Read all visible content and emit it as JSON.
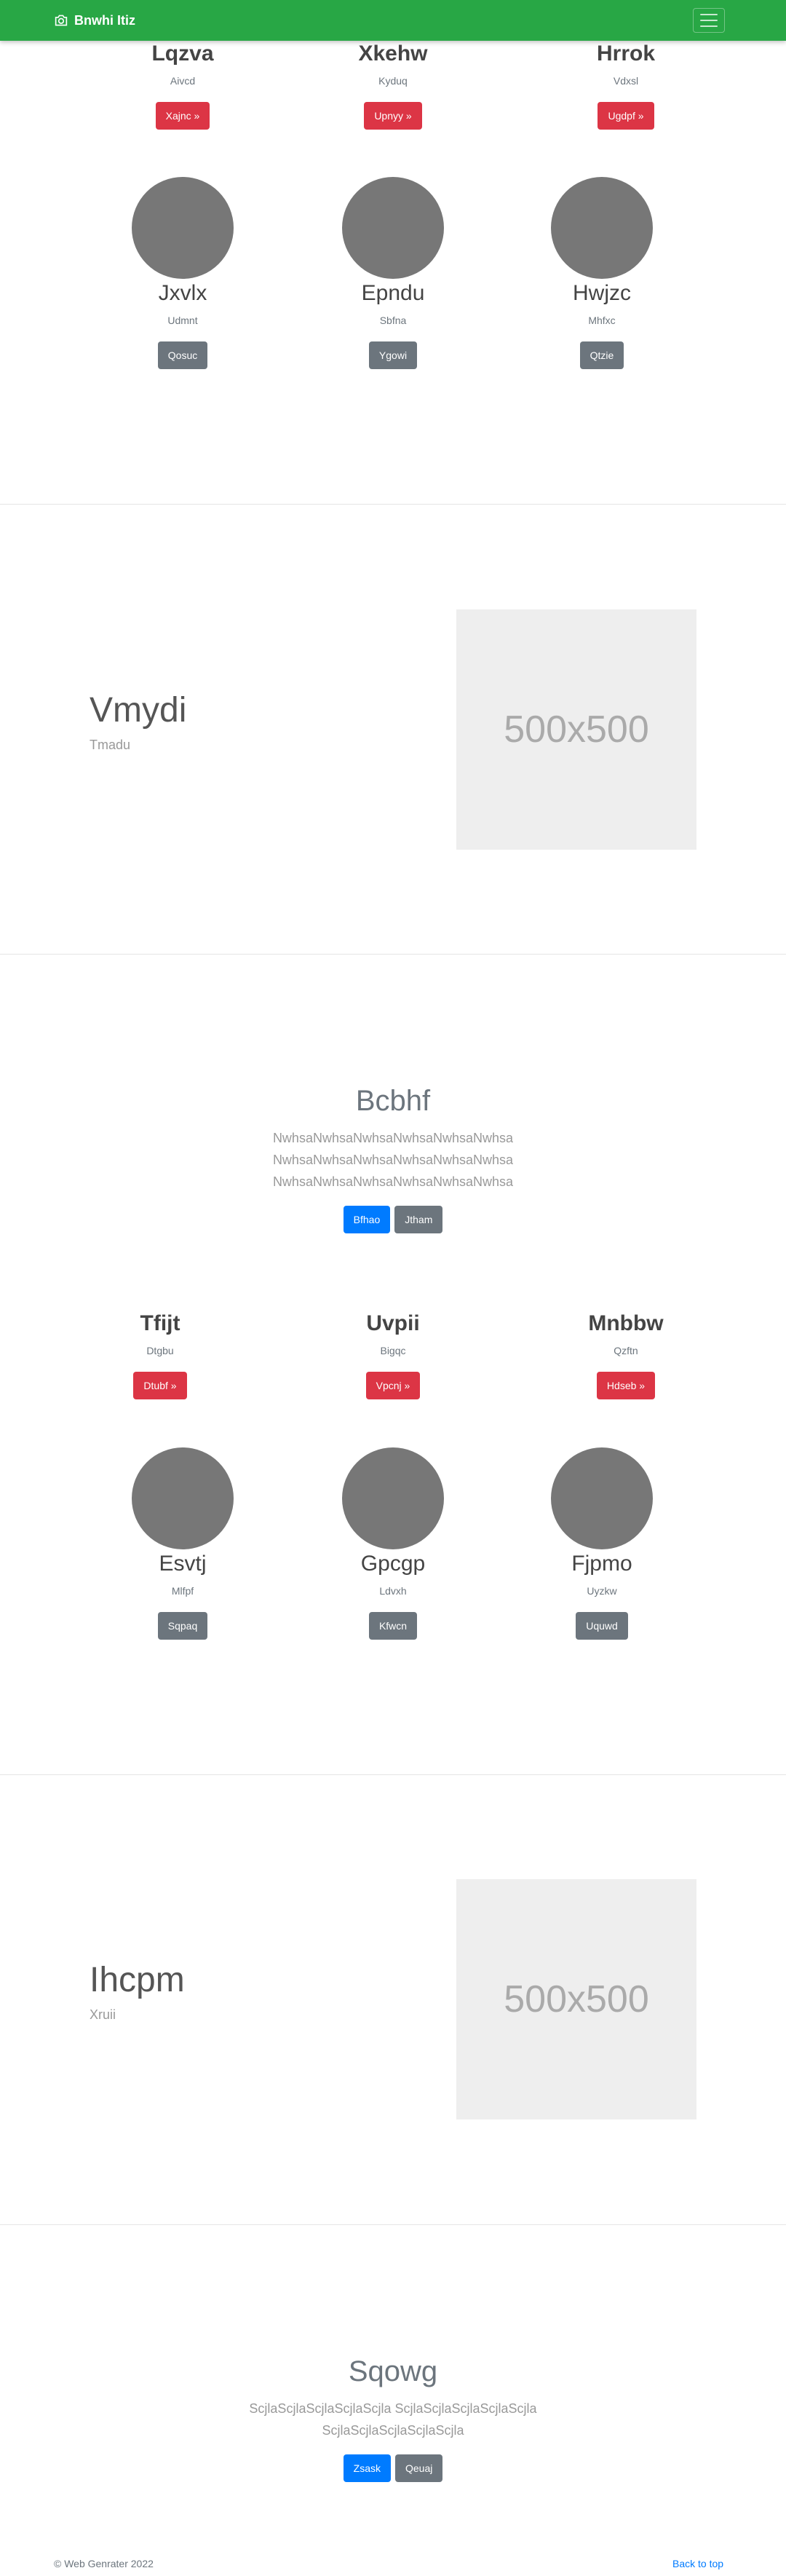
{
  "navbar": {
    "brand": "Bnwhi Itiz",
    "brand_icon": "camera-icon",
    "toggler_icon": "hamburger-icon"
  },
  "features1": [
    {
      "title": "Lqzva",
      "subtitle": "Aivcd",
      "button": "Xajnc »"
    },
    {
      "title": "Xkehw",
      "subtitle": "Kyduq",
      "button": "Upnyy »"
    },
    {
      "title": "Hrrok",
      "subtitle": "Vdxsl",
      "button": "Ugdpf »"
    }
  ],
  "members1": [
    {
      "name": "Jxvlx",
      "subtitle": "Udmnt",
      "button": "Qosuc"
    },
    {
      "name": "Epndu",
      "subtitle": "Sbfna",
      "button": "Ygowi"
    },
    {
      "name": "Hwjzc",
      "subtitle": "Mhfxc",
      "button": "Qtzie"
    }
  ],
  "split1": {
    "title": "Vmydi",
    "subtitle": "Tmadu",
    "image_label": "500x500"
  },
  "hero1": {
    "title": "Bcbhf",
    "lines": [
      "NwhsaNwhsaNwhsaNwhsaNwhsaNwhsa",
      "NwhsaNwhsaNwhsaNwhsaNwhsaNwhsa",
      "NwhsaNwhsaNwhsaNwhsaNwhsaNwhsa"
    ],
    "primary_button": "Bfhao",
    "secondary_button": "Jtham"
  },
  "features2": [
    {
      "title": "Tfijt",
      "subtitle": "Dtgbu",
      "button": "Dtubf »"
    },
    {
      "title": "Uvpii",
      "subtitle": "Bigqc",
      "button": "Vpcnj »"
    },
    {
      "title": "Mnbbw",
      "subtitle": "Qzftn",
      "button": "Hdseb »"
    }
  ],
  "members2": [
    {
      "name": "Esvtj",
      "subtitle": "Mlfpf",
      "button": "Sqpaq"
    },
    {
      "name": "Gpcgp",
      "subtitle": "Ldvxh",
      "button": "Kfwcn"
    },
    {
      "name": "Fjpmo",
      "subtitle": "Uyzkw",
      "button": "Uquwd"
    }
  ],
  "split2": {
    "title": "Ihcpm",
    "subtitle": "Xruii",
    "image_label": "500x500"
  },
  "hero2": {
    "title": "Sqowg",
    "lines": [
      "ScjlaScjlaScjlaScjlaScjla ScjlaScjlaScjlaScjlaScjla",
      "ScjlaScjlaScjlaScjlaScjla"
    ],
    "primary_button": "Zsask",
    "secondary_button": "Qeuaj"
  },
  "footer": {
    "copyright": "© Web Genrater 2022",
    "back_to_top": "Back to top"
  },
  "colors": {
    "navbar": "#28a745",
    "danger": "#dc3545",
    "secondary": "#6c757d",
    "primary": "#007bff",
    "avatar": "#777777",
    "placeholder_bg": "#eeeeee"
  }
}
